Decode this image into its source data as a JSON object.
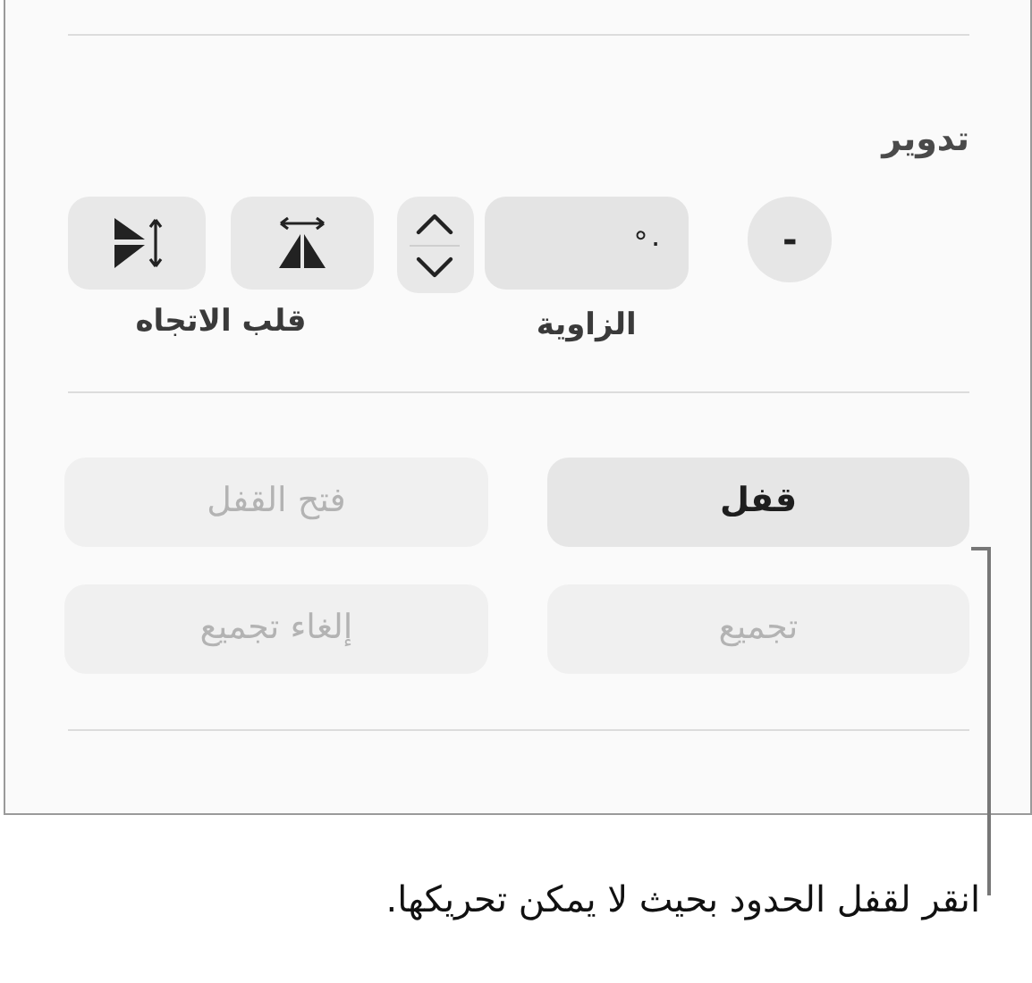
{
  "panel": {
    "section_title": "تدوير",
    "rotation": {
      "minus_button": "-",
      "angle": {
        "value": "٠°",
        "label": "الزاوية"
      },
      "flip": {
        "label": "قلب الاتجاه"
      }
    },
    "buttons": [
      {
        "label": "قفل",
        "disabled": false
      },
      {
        "label": "فتح القفل",
        "disabled": true
      },
      {
        "label": "تجميع",
        "disabled": true
      },
      {
        "label": "إلغاء تجميع",
        "disabled": true
      }
    ]
  },
  "callout": "انقر لقفل الحدود بحيث لا يمكن تحريكها."
}
